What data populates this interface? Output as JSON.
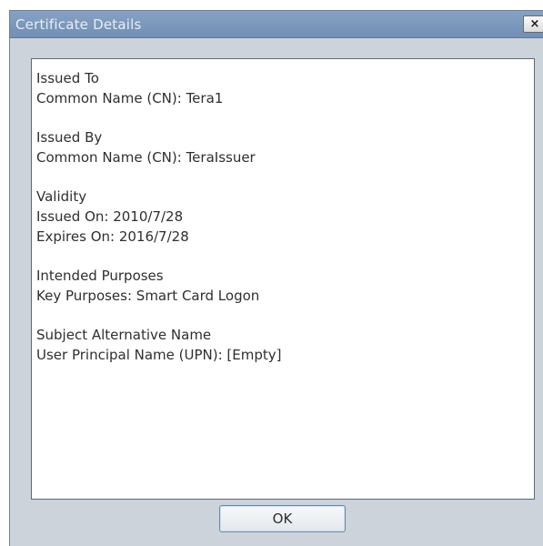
{
  "dialog": {
    "title": "Certificate Details",
    "close_symbol": "×",
    "close_icon": "close-icon",
    "ok_label": "OK"
  },
  "certificate": {
    "issued_to": {
      "heading": "Issued To",
      "common_name": "Common Name (CN): Tera1"
    },
    "issued_by": {
      "heading": "Issued By",
      "common_name": "Common Name (CN): TeraIssuer"
    },
    "validity": {
      "heading": "Validity",
      "issued_on": "Issued On: 2010/7/28",
      "expires_on": "Expires On: 2016/7/28"
    },
    "intended_purposes": {
      "heading": "Intended Purposes",
      "key_purposes": "Key Purposes: Smart Card Logon"
    },
    "subject_alternative_name": {
      "heading": "Subject Alternative Name",
      "upn": "User Principal Name (UPN): [Empty]"
    }
  },
  "colors": {
    "titlebar": "#7f9bbf",
    "dialog_background": "#cdd3da",
    "content_background": "#ffffff",
    "text": "#2f2f2f"
  }
}
